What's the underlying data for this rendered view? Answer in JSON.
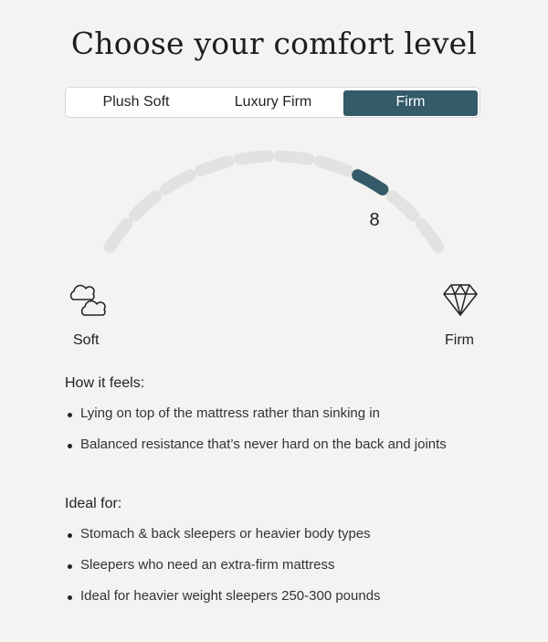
{
  "title": "Choose your comfort level",
  "tabs": [
    {
      "label": "Plush Soft",
      "active": false
    },
    {
      "label": "Luxury Firm",
      "active": false
    },
    {
      "label": "Firm",
      "active": true
    }
  ],
  "gauge": {
    "rating": "8",
    "min": 1,
    "max": 10,
    "value": 8,
    "active_color": "#355a68",
    "inactive_color": "#e3e2e0",
    "left_label": "Soft",
    "right_label": "Firm",
    "left_icon": "cloud-icon",
    "right_icon": "diamond-icon"
  },
  "how_it_feels": {
    "heading": "How it feels:",
    "items": [
      "Lying on top of the mattress rather than sinking in",
      "Balanced resistance that’s never hard on the back and joints"
    ]
  },
  "ideal_for": {
    "heading": "Ideal for:",
    "items": [
      "Stomach & back sleepers or heavier body types",
      "Sleepers who need an extra-firm mattress",
      "Ideal for heavier weight sleepers 250-300 pounds"
    ]
  }
}
